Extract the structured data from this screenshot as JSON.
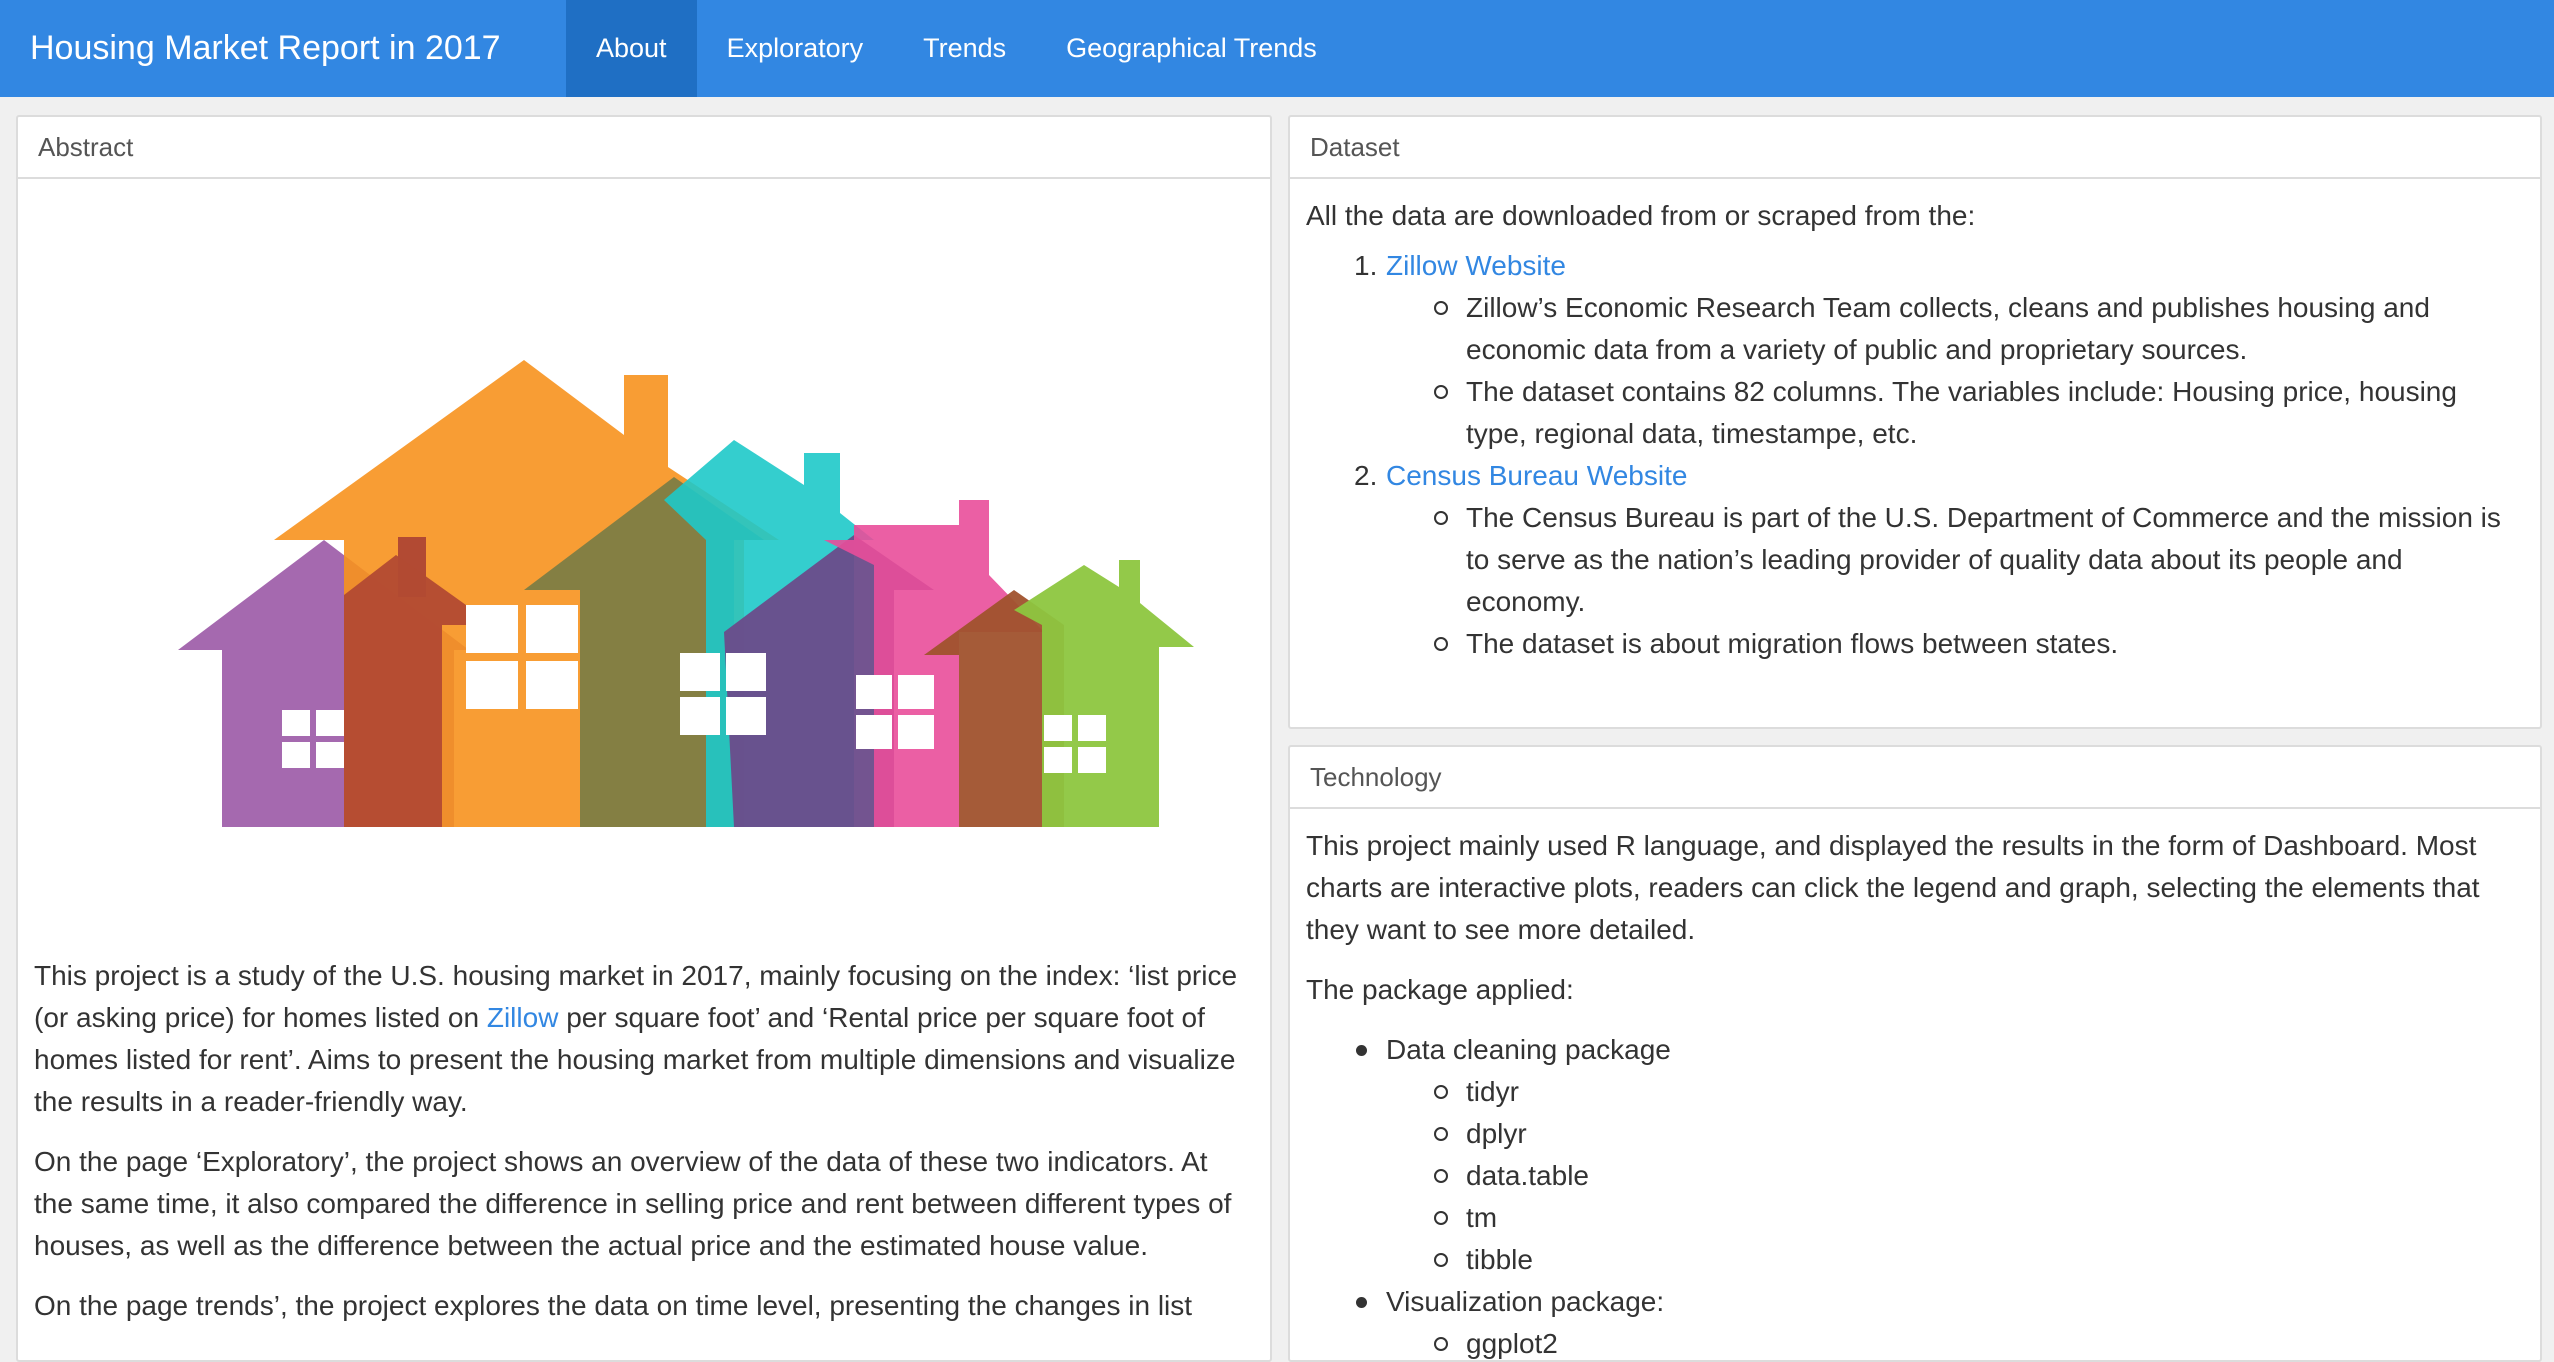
{
  "navbar": {
    "title": "Housing Market Report in 2017",
    "tabs": [
      {
        "label": "About",
        "active": true
      },
      {
        "label": "Exploratory",
        "active": false
      },
      {
        "label": "Trends",
        "active": false
      },
      {
        "label": "Geographical Trends",
        "active": false
      }
    ]
  },
  "abstract": {
    "header": "Abstract",
    "p1_before": "This project is a study of the U.S. housing market in 2017, mainly focusing on the index: ‘list price (or asking price) for homes listed on ",
    "p1_link": "Zillow",
    "p1_after": " per square foot’ and ‘Rental price per square foot of homes listed for rent’. Aims to present the housing market from multiple dimensions and visualize the results in a reader-friendly way.",
    "p2": "On the page ‘Exploratory’, the project shows an overview of the data of these two indicators. At the same time, it also compared the difference in selling price and rent between different types of houses, as well as the difference between the actual price and the estimated house value.",
    "p3": "On the page trends’, the project explores the data on time level, presenting the changes in list"
  },
  "dataset": {
    "header": "Dataset",
    "intro": "All the data are downloaded from or scraped from the:",
    "sources": [
      {
        "num": "1.",
        "link": "Zillow Website",
        "bullets": [
          "Zillow’s Economic Research Team collects, cleans and publishes housing and economic data from a variety of public and proprietary sources.",
          "The dataset contains 82 columns. The variables include: Housing price, housing type, regional data, timestampe, etc."
        ]
      },
      {
        "num": "2.",
        "link": "Census Bureau Website",
        "bullets": [
          "The Census Bureau is part of the U.S. Department of Commerce and the mission is to serve as the nation’s leading provider of quality data about its people and economy.",
          "The dataset is about migration flows between states."
        ]
      }
    ]
  },
  "technology": {
    "header": "Technology",
    "intro": "This project mainly used R language, and displayed the results in the form of Dashboard. Most charts are interactive plots, readers can click the legend and graph, selecting the elements that they want to see more detailed.",
    "packages_label": "The package applied:",
    "groups": [
      {
        "label": "Data cleaning package",
        "items": [
          "tidyr",
          "dplyr",
          "data.table",
          "tm",
          "tibble"
        ]
      },
      {
        "label": "Visualization package:",
        "items": [
          "ggplot2"
        ]
      }
    ]
  },
  "colors": {
    "navbar": "#3287e2",
    "active_tab": "#1f6fc4",
    "link": "#3287e2"
  }
}
